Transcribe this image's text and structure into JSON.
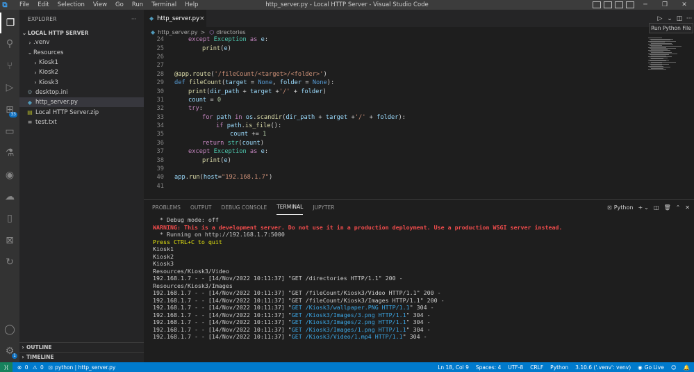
{
  "window": {
    "title": "http_server.py - Local HTTP Server - Visual Studio Code",
    "logo": "vscode-logo",
    "menu": [
      "File",
      "Edit",
      "Selection",
      "View",
      "Go",
      "Run",
      "Terminal",
      "Help"
    ]
  },
  "activity_bar": {
    "items": [
      "explorer-icon",
      "search-icon",
      "source-control-icon",
      "run-debug-icon",
      "extensions-icon",
      "remote-explorer-icon",
      "testing-icon",
      "gitlens-icon",
      "docker-icon",
      "notebook-icon",
      "python-icon",
      "live-share-icon",
      "accounts-icon",
      "manage-icon"
    ],
    "extensions_badge": "33",
    "manage_badge": "1"
  },
  "explorer": {
    "header": "EXPLORER",
    "more": "···",
    "root": "LOCAL HTTP SERVER",
    "items": [
      {
        "label": ".venv",
        "kind": "folder-closed",
        "depth": 1
      },
      {
        "label": "Resources",
        "kind": "folder-open",
        "depth": 1
      },
      {
        "label": "Kiosk1",
        "kind": "folder-closed",
        "depth": 2
      },
      {
        "label": "Kiosk2",
        "kind": "folder-closed",
        "depth": 2
      },
      {
        "label": "Kiosk3",
        "kind": "folder-closed",
        "depth": 2
      },
      {
        "label": "desktop.ini",
        "kind": "file-ini",
        "depth": 1
      },
      {
        "label": "http_server.py",
        "kind": "file-python",
        "depth": 1,
        "selected": true
      },
      {
        "label": "Local HTTP Server.zip",
        "kind": "file-zip",
        "depth": 1
      },
      {
        "label": "test.txt",
        "kind": "file-text",
        "depth": 1
      }
    ],
    "outline": "OUTLINE",
    "timeline": "TIMELINE"
  },
  "editor": {
    "tab": {
      "label": "http_server.py",
      "close": "×"
    },
    "run_tooltip": "Run Python File",
    "breadcrumb": {
      "file": "http_server.py",
      "sep": ">",
      "symbol": "directories"
    },
    "lines": [
      {
        "n": "24",
        "indent": 1,
        "t": [
          [
            "ctrl",
            "except "
          ],
          [
            "cls",
            "Exception"
          ],
          [
            "ctrl",
            " as "
          ],
          [
            "var",
            "e"
          ],
          [
            "plain",
            ":"
          ]
        ]
      },
      {
        "n": "25",
        "indent": 2,
        "t": [
          [
            "fn",
            "print"
          ],
          [
            "plain",
            "("
          ],
          [
            "var",
            "e"
          ],
          [
            "plain",
            ")"
          ]
        ]
      },
      {
        "n": "26",
        "indent": 0,
        "t": []
      },
      {
        "n": "27",
        "indent": 0,
        "t": []
      },
      {
        "n": "28",
        "indent": 0,
        "t": [
          [
            "fn",
            "@app.route"
          ],
          [
            "plain",
            "("
          ],
          [
            "str",
            "'/fileCount/<target>/<folder>'"
          ],
          [
            "plain",
            ")"
          ]
        ]
      },
      {
        "n": "29",
        "indent": 0,
        "t": [
          [
            "kw",
            "def "
          ],
          [
            "fn",
            "fileCount"
          ],
          [
            "plain",
            "("
          ],
          [
            "var",
            "target"
          ],
          [
            "plain",
            " = "
          ],
          [
            "kw",
            "None"
          ],
          [
            "plain",
            ", "
          ],
          [
            "var",
            "folder"
          ],
          [
            "plain",
            " = "
          ],
          [
            "kw",
            "None"
          ],
          [
            "plain",
            "):"
          ]
        ]
      },
      {
        "n": "30",
        "indent": 1,
        "t": [
          [
            "fn",
            "print"
          ],
          [
            "plain",
            "("
          ],
          [
            "var",
            "dir_path"
          ],
          [
            "plain",
            " + "
          ],
          [
            "var",
            "target"
          ],
          [
            "plain",
            " +"
          ],
          [
            "str",
            "'/'"
          ],
          [
            "plain",
            " + "
          ],
          [
            "var",
            "folder"
          ],
          [
            "plain",
            ")"
          ]
        ]
      },
      {
        "n": "31",
        "indent": 1,
        "t": [
          [
            "var",
            "count"
          ],
          [
            "plain",
            " = "
          ],
          [
            "num",
            "0"
          ]
        ]
      },
      {
        "n": "32",
        "indent": 1,
        "t": [
          [
            "ctrl",
            "try"
          ],
          [
            "plain",
            ":"
          ]
        ]
      },
      {
        "n": "33",
        "indent": 2,
        "t": [
          [
            "ctrl",
            "for "
          ],
          [
            "var",
            "path"
          ],
          [
            "ctrl",
            " in "
          ],
          [
            "var",
            "os"
          ],
          [
            "plain",
            "."
          ],
          [
            "fn",
            "scandir"
          ],
          [
            "plain",
            "("
          ],
          [
            "var",
            "dir_path"
          ],
          [
            "plain",
            " + "
          ],
          [
            "var",
            "target"
          ],
          [
            "plain",
            " +"
          ],
          [
            "str",
            "'/'"
          ],
          [
            "plain",
            " + "
          ],
          [
            "var",
            "folder"
          ],
          [
            "plain",
            "):"
          ]
        ]
      },
      {
        "n": "34",
        "indent": 3,
        "t": [
          [
            "ctrl",
            "if "
          ],
          [
            "var",
            "path"
          ],
          [
            "plain",
            "."
          ],
          [
            "fn",
            "is_file"
          ],
          [
            "plain",
            "():"
          ]
        ]
      },
      {
        "n": "35",
        "indent": 4,
        "t": [
          [
            "var",
            "count"
          ],
          [
            "plain",
            " += "
          ],
          [
            "num",
            "1"
          ]
        ]
      },
      {
        "n": "36",
        "indent": 2,
        "t": [
          [
            "ctrl",
            "return "
          ],
          [
            "cls",
            "str"
          ],
          [
            "plain",
            "("
          ],
          [
            "var",
            "count"
          ],
          [
            "plain",
            ")"
          ]
        ]
      },
      {
        "n": "37",
        "indent": 1,
        "t": [
          [
            "ctrl",
            "except "
          ],
          [
            "cls",
            "Exception"
          ],
          [
            "ctrl",
            " as "
          ],
          [
            "var",
            "e"
          ],
          [
            "plain",
            ":"
          ]
        ]
      },
      {
        "n": "38",
        "indent": 2,
        "t": [
          [
            "fn",
            "print"
          ],
          [
            "plain",
            "("
          ],
          [
            "var",
            "e"
          ],
          [
            "plain",
            ")"
          ]
        ]
      },
      {
        "n": "39",
        "indent": 0,
        "t": []
      },
      {
        "n": "40",
        "indent": 0,
        "t": [
          [
            "var",
            "app"
          ],
          [
            "plain",
            "."
          ],
          [
            "fn",
            "run"
          ],
          [
            "plain",
            "("
          ],
          [
            "var",
            "host"
          ],
          [
            "plain",
            "="
          ],
          [
            "str",
            "\"192.168.1.7\""
          ],
          [
            "plain",
            ")"
          ]
        ]
      },
      {
        "n": "41",
        "indent": 0,
        "t": []
      }
    ]
  },
  "panel": {
    "tabs": [
      "PROBLEMS",
      "OUTPUT",
      "DEBUG CONSOLE",
      "TERMINAL",
      "JUPYTER"
    ],
    "active_tab": "TERMINAL",
    "terminal_name": "Python",
    "terminal_lines": [
      [
        [
          "",
          "  * Debug mode: off"
        ]
      ],
      [
        [
          "red",
          "WARNING: This is a development server. Do not use it in a production deployment. Use a production WSGI server instead."
        ]
      ],
      [
        [
          "",
          "  * Running on http://192.168.1.7:5000"
        ]
      ],
      [
        [
          "yel",
          "Press CTRL+C to quit"
        ]
      ],
      [
        [
          "",
          "Kiosk1"
        ]
      ],
      [
        [
          "",
          "Kiosk2"
        ]
      ],
      [
        [
          "",
          "Kiosk3"
        ]
      ],
      [
        [
          "",
          "Resources/Kiosk3/Video"
        ]
      ],
      [
        [
          "",
          "192.168.1.7 - - [14/Nov/2022 10:11:37] \"GET /directories HTTP/1.1\" 200 -"
        ]
      ],
      [
        [
          "",
          "Resources/Kiosk3/Images"
        ]
      ],
      [
        [
          "",
          "192.168.1.7 - - [14/Nov/2022 10:11:37] \"GET /fileCount/Kiosk3/Video HTTP/1.1\" 200 -"
        ]
      ],
      [
        [
          "",
          "192.168.1.7 - - [14/Nov/2022 10:11:37] \"GET /fileCount/Kiosk3/Images HTTP/1.1\" 200 -"
        ]
      ],
      [
        [
          "",
          "192.168.1.7 - - [14/Nov/2022 10:11:37] \""
        ],
        [
          "cyan",
          "GET /Kiosk3/wallpaper.PNG HTTP/1.1"
        ],
        [
          "",
          "\" 304 -"
        ]
      ],
      [
        [
          "",
          "192.168.1.7 - - [14/Nov/2022 10:11:37] \""
        ],
        [
          "cyan",
          "GET /Kiosk3/Images/3.png HTTP/1.1"
        ],
        [
          "",
          "\" 304 -"
        ]
      ],
      [
        [
          "",
          "192.168.1.7 - - [14/Nov/2022 10:11:37] \""
        ],
        [
          "cyan",
          "GET /Kiosk3/Images/2.png HTTP/1.1"
        ],
        [
          "",
          "\" 304 -"
        ]
      ],
      [
        [
          "",
          "192.168.1.7 - - [14/Nov/2022 10:11:37] \""
        ],
        [
          "cyan",
          "GET /Kiosk3/Images/1.png HTTP/1.1"
        ],
        [
          "",
          "\" 304 -"
        ]
      ],
      [
        [
          "",
          "192.168.1.7 - - [14/Nov/2022 10:11:37] \""
        ],
        [
          "cyan",
          "GET /Kiosk3/Video/1.mp4 HTTP/1.1"
        ],
        [
          "",
          "\" 304 -"
        ]
      ]
    ]
  },
  "status": {
    "errors": "0",
    "warnings": "0",
    "terminal": "python | http_server.py",
    "position": "Ln 18, Col 9",
    "spaces": "Spaces: 4",
    "encoding": "UTF-8",
    "eol": "CRLF",
    "language": "Python",
    "interpreter": "3.10.6 ('.venv': venv)",
    "live": "Go Live"
  }
}
